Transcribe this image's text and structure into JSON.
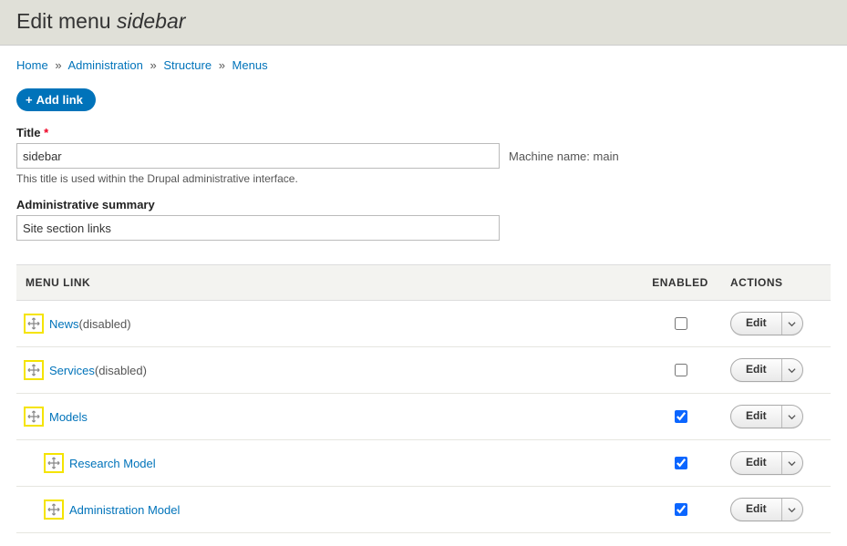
{
  "page": {
    "title_prefix": "Edit menu ",
    "title_em": "sidebar"
  },
  "breadcrumb": {
    "items": [
      "Home",
      "Administration",
      "Structure",
      "Menus"
    ]
  },
  "buttons": {
    "add_link": "Add link",
    "edit": "Edit"
  },
  "fields": {
    "title": {
      "label": "Title",
      "value": "sidebar",
      "help": "This title is used within the Drupal administrative interface.",
      "machine_label": "Machine name:",
      "machine_value": "main"
    },
    "summary": {
      "label": "Administrative summary",
      "value": "Site section links"
    }
  },
  "table": {
    "headers": {
      "link": "MENU LINK",
      "enabled": "ENABLED",
      "actions": "ACTIONS"
    },
    "rows": [
      {
        "label": "News",
        "suffix": "(disabled)",
        "enabled": false,
        "indent": 0,
        "highlight": true
      },
      {
        "label": "Services",
        "suffix": "(disabled)",
        "enabled": false,
        "indent": 0,
        "highlight": true
      },
      {
        "label": "Models",
        "suffix": "",
        "enabled": true,
        "indent": 0,
        "highlight": true
      },
      {
        "label": "Research Model",
        "suffix": "",
        "enabled": true,
        "indent": 1,
        "highlight": true
      },
      {
        "label": "Administration Model",
        "suffix": "",
        "enabled": true,
        "indent": 1,
        "highlight": true
      }
    ]
  }
}
